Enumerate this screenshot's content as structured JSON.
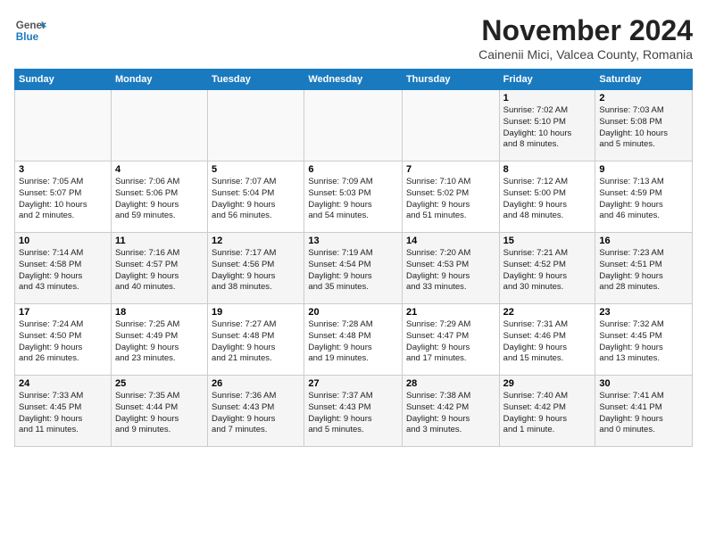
{
  "logo": {
    "line1": "General",
    "line2": "Blue"
  },
  "title": "November 2024",
  "subtitle": "Cainenii Mici, Valcea County, Romania",
  "weekdays": [
    "Sunday",
    "Monday",
    "Tuesday",
    "Wednesday",
    "Thursday",
    "Friday",
    "Saturday"
  ],
  "weeks": [
    [
      {
        "day": "",
        "info": ""
      },
      {
        "day": "",
        "info": ""
      },
      {
        "day": "",
        "info": ""
      },
      {
        "day": "",
        "info": ""
      },
      {
        "day": "",
        "info": ""
      },
      {
        "day": "1",
        "info": "Sunrise: 7:02 AM\nSunset: 5:10 PM\nDaylight: 10 hours\nand 8 minutes."
      },
      {
        "day": "2",
        "info": "Sunrise: 7:03 AM\nSunset: 5:08 PM\nDaylight: 10 hours\nand 5 minutes."
      }
    ],
    [
      {
        "day": "3",
        "info": "Sunrise: 7:05 AM\nSunset: 5:07 PM\nDaylight: 10 hours\nand 2 minutes."
      },
      {
        "day": "4",
        "info": "Sunrise: 7:06 AM\nSunset: 5:06 PM\nDaylight: 9 hours\nand 59 minutes."
      },
      {
        "day": "5",
        "info": "Sunrise: 7:07 AM\nSunset: 5:04 PM\nDaylight: 9 hours\nand 56 minutes."
      },
      {
        "day": "6",
        "info": "Sunrise: 7:09 AM\nSunset: 5:03 PM\nDaylight: 9 hours\nand 54 minutes."
      },
      {
        "day": "7",
        "info": "Sunrise: 7:10 AM\nSunset: 5:02 PM\nDaylight: 9 hours\nand 51 minutes."
      },
      {
        "day": "8",
        "info": "Sunrise: 7:12 AM\nSunset: 5:00 PM\nDaylight: 9 hours\nand 48 minutes."
      },
      {
        "day": "9",
        "info": "Sunrise: 7:13 AM\nSunset: 4:59 PM\nDaylight: 9 hours\nand 46 minutes."
      }
    ],
    [
      {
        "day": "10",
        "info": "Sunrise: 7:14 AM\nSunset: 4:58 PM\nDaylight: 9 hours\nand 43 minutes."
      },
      {
        "day": "11",
        "info": "Sunrise: 7:16 AM\nSunset: 4:57 PM\nDaylight: 9 hours\nand 40 minutes."
      },
      {
        "day": "12",
        "info": "Sunrise: 7:17 AM\nSunset: 4:56 PM\nDaylight: 9 hours\nand 38 minutes."
      },
      {
        "day": "13",
        "info": "Sunrise: 7:19 AM\nSunset: 4:54 PM\nDaylight: 9 hours\nand 35 minutes."
      },
      {
        "day": "14",
        "info": "Sunrise: 7:20 AM\nSunset: 4:53 PM\nDaylight: 9 hours\nand 33 minutes."
      },
      {
        "day": "15",
        "info": "Sunrise: 7:21 AM\nSunset: 4:52 PM\nDaylight: 9 hours\nand 30 minutes."
      },
      {
        "day": "16",
        "info": "Sunrise: 7:23 AM\nSunset: 4:51 PM\nDaylight: 9 hours\nand 28 minutes."
      }
    ],
    [
      {
        "day": "17",
        "info": "Sunrise: 7:24 AM\nSunset: 4:50 PM\nDaylight: 9 hours\nand 26 minutes."
      },
      {
        "day": "18",
        "info": "Sunrise: 7:25 AM\nSunset: 4:49 PM\nDaylight: 9 hours\nand 23 minutes."
      },
      {
        "day": "19",
        "info": "Sunrise: 7:27 AM\nSunset: 4:48 PM\nDaylight: 9 hours\nand 21 minutes."
      },
      {
        "day": "20",
        "info": "Sunrise: 7:28 AM\nSunset: 4:48 PM\nDaylight: 9 hours\nand 19 minutes."
      },
      {
        "day": "21",
        "info": "Sunrise: 7:29 AM\nSunset: 4:47 PM\nDaylight: 9 hours\nand 17 minutes."
      },
      {
        "day": "22",
        "info": "Sunrise: 7:31 AM\nSunset: 4:46 PM\nDaylight: 9 hours\nand 15 minutes."
      },
      {
        "day": "23",
        "info": "Sunrise: 7:32 AM\nSunset: 4:45 PM\nDaylight: 9 hours\nand 13 minutes."
      }
    ],
    [
      {
        "day": "24",
        "info": "Sunrise: 7:33 AM\nSunset: 4:45 PM\nDaylight: 9 hours\nand 11 minutes."
      },
      {
        "day": "25",
        "info": "Sunrise: 7:35 AM\nSunset: 4:44 PM\nDaylight: 9 hours\nand 9 minutes."
      },
      {
        "day": "26",
        "info": "Sunrise: 7:36 AM\nSunset: 4:43 PM\nDaylight: 9 hours\nand 7 minutes."
      },
      {
        "day": "27",
        "info": "Sunrise: 7:37 AM\nSunset: 4:43 PM\nDaylight: 9 hours\nand 5 minutes."
      },
      {
        "day": "28",
        "info": "Sunrise: 7:38 AM\nSunset: 4:42 PM\nDaylight: 9 hours\nand 3 minutes."
      },
      {
        "day": "29",
        "info": "Sunrise: 7:40 AM\nSunset: 4:42 PM\nDaylight: 9 hours\nand 1 minute."
      },
      {
        "day": "30",
        "info": "Sunrise: 7:41 AM\nSunset: 4:41 PM\nDaylight: 9 hours\nand 0 minutes."
      }
    ]
  ]
}
